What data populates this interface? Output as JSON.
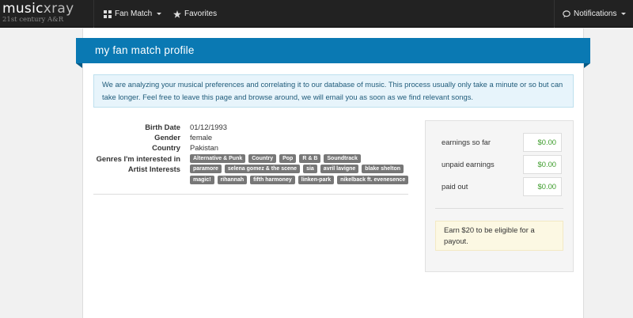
{
  "nav": {
    "logo_main_a": "music",
    "logo_main_b": "xray",
    "logo_sub": "21st century A&R",
    "fan_match": "Fan Match",
    "favorites": "Favorites",
    "notifications": "Notifications"
  },
  "header": {
    "title": "my fan match profile"
  },
  "alert": {
    "text": "We are analyzing your musical preferences and correlating it to our database of music. This process usually only take a minute or so but can take longer. Feel free to leave this page and browse around, we will email you as soon as we find relevant songs."
  },
  "profile": {
    "birth_label": "Birth Date",
    "birth_value": "01/12/1993",
    "gender_label": "Gender",
    "gender_value": "female",
    "country_label": "Country",
    "country_value": "Pakistan",
    "genres_label": "Genres I'm interested in",
    "genres": [
      "Alternative & Punk",
      "Country",
      "Pop",
      "R & B",
      "Soundtrack"
    ],
    "artists_label": "Artist Interests",
    "artists_row1": [
      "paramore",
      "selena gomez & the scene",
      "sia",
      "avril lavigne",
      "blake shelton"
    ],
    "artists_row2": [
      "magic!",
      "rihannah",
      "fifth harmoney",
      "linken-park",
      "nikelback ft. evenesence"
    ]
  },
  "earnings": {
    "so_far_label": "earnings so far",
    "so_far_value": "$0.00",
    "unpaid_label": "unpaid earnings",
    "unpaid_value": "$0.00",
    "paid_label": "paid out",
    "paid_value": "$0.00",
    "note": "Earn $20 to be eligible for a payout."
  },
  "colors": {
    "accent": "#0a79b3",
    "navbar": "#222222",
    "money": "#3c9c2a"
  }
}
